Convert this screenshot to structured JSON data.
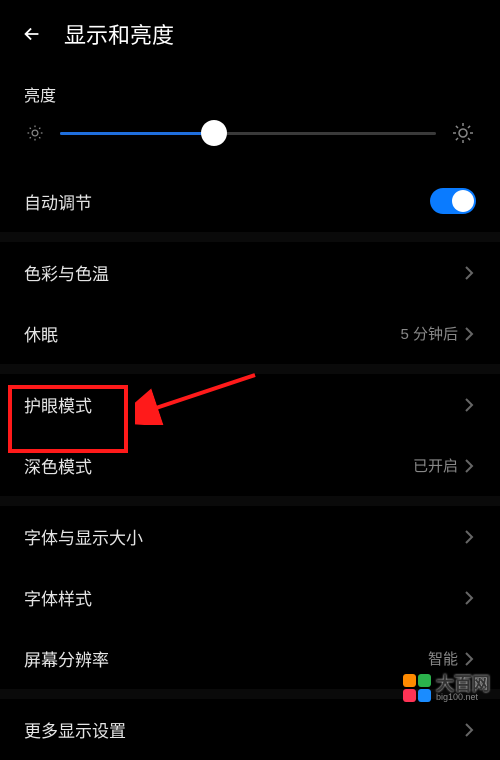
{
  "header": {
    "title": "显示和亮度"
  },
  "brightness": {
    "label": "亮度",
    "value_percent": 41
  },
  "auto_brightness": {
    "label": "自动调节",
    "enabled": true
  },
  "rows": {
    "color_temp": {
      "label": "色彩与色温",
      "value": ""
    },
    "sleep": {
      "label": "休眠",
      "value": "5 分钟后"
    },
    "eye_comfort": {
      "label": "护眼模式",
      "value": ""
    },
    "dark_mode": {
      "label": "深色模式",
      "value": "已开启"
    },
    "font_display_size": {
      "label": "字体与显示大小",
      "value": ""
    },
    "font_style": {
      "label": "字体样式",
      "value": ""
    },
    "screen_resolution": {
      "label": "屏幕分辨率",
      "value": "智能"
    },
    "more_display": {
      "label": "更多显示设置",
      "value": ""
    }
  },
  "annotation": {
    "highlighted_item": "dark_mode"
  },
  "watermark": {
    "brand": "大百网",
    "domain": "big100.net"
  }
}
